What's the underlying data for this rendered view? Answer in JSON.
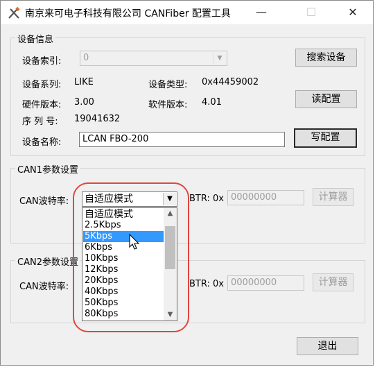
{
  "window": {
    "title": "南京来可电子科技有限公司 CANFiber 配置工具",
    "minimize": "—",
    "maximize": "☐",
    "close": "✕"
  },
  "device_info": {
    "group_title": "设备信息",
    "index_label": "设备索引:",
    "index_value": "0",
    "search_button": "搜索设备",
    "series_label": "设备系列:",
    "series_value": "LIKE",
    "type_label": "设备类型:",
    "type_value": "0x44459002",
    "hw_label": "硬件版本:",
    "hw_value": "3.00",
    "sw_label": "软件版本:",
    "sw_value": "4.01",
    "read_button": "读配置",
    "serial_label": "序 列 号:",
    "serial_value": "19041632",
    "name_label": "设备名称:",
    "name_value": "LCAN FBO-200",
    "write_button": "写配置"
  },
  "can1": {
    "group_title": "CAN1参数设置",
    "baud_label": "CAN波特率:",
    "baud_value": "自适应模式",
    "btr_label": "BTR: 0x",
    "btr_value": "00000000",
    "calc_button": "计算器"
  },
  "can2": {
    "group_title": "CAN2参数设置",
    "baud_label": "CAN波特率:",
    "btr_label": "BTR: 0x",
    "btr_value": "00000000",
    "calc_button": "计算器"
  },
  "dropdown": {
    "options": [
      "自适应模式",
      "2.5Kbps",
      "5Kbps",
      "6Kbps",
      "10Kbps",
      "12Kbps",
      "20Kbps",
      "40Kbps",
      "50Kbps",
      "80Kbps"
    ],
    "selected": "5Kbps"
  },
  "exit_button": "退出",
  "colors": {
    "selection": "#3399ff",
    "highlight_ring": "#e0463f",
    "window_bg": "#f0f0f0"
  },
  "icons": {
    "app": "tools-icon",
    "combo_arrow": "chevron-down-icon",
    "cursor": "mouse-pointer-icon"
  }
}
